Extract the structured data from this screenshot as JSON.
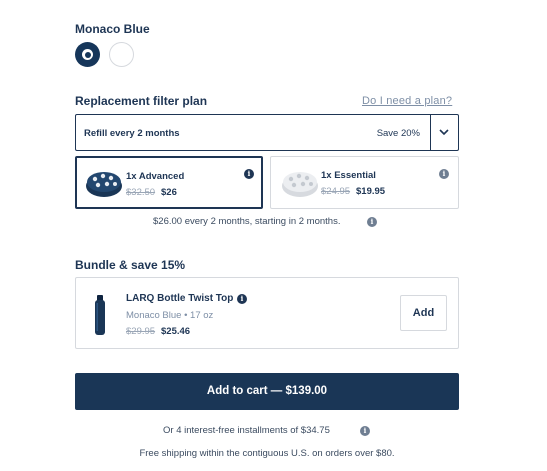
{
  "color": {
    "selected_name": "Monaco Blue",
    "swatches": [
      {
        "name": "Monaco Blue",
        "hex": "#16365a",
        "selected": true
      },
      {
        "name": "white",
        "hex": "#ffffff",
        "selected": false
      }
    ]
  },
  "plan": {
    "heading": "Replacement filter plan",
    "help_link": "Do I need a plan?",
    "select_value": "Refill every 2 months",
    "select_badge": "Save 20%",
    "options": [
      {
        "title": "1x Advanced",
        "old_price": "$32.50",
        "new_price": "$26",
        "selected": true
      },
      {
        "title": "1x Essential",
        "old_price": "$24.95",
        "new_price": "$19.95",
        "selected": false
      }
    ],
    "schedule_text": "$26.00 every 2 months, starting in 2 months."
  },
  "bundle": {
    "heading": "Bundle & save 15%",
    "product_name": "LARQ Bottle Twist Top",
    "variant": "Monaco Blue • 17 oz",
    "old_price": "$29.95",
    "new_price": "$25.46",
    "add_label": "Add"
  },
  "cart": {
    "button_label": "Add to cart — $139.00",
    "installments": "Or 4 interest-free installments of $34.75",
    "shipping_note": "Free shipping within the contiguous U.S. on orders over $80."
  },
  "colors": {
    "primary": "#1a3656",
    "border": "#d6d9de",
    "muted": "#7e8fa6"
  }
}
